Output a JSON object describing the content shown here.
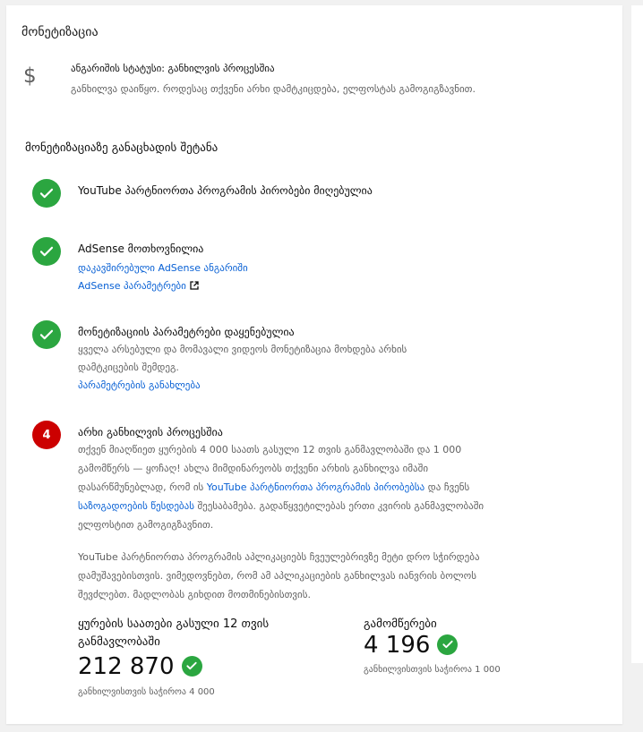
{
  "page": {
    "title": "მონეტიზაცია"
  },
  "account_status": {
    "icon": "dollar-icon",
    "title": "ანგარიშის სტატუსი: განხილვის პროცესშია",
    "description": "განხილვა დაიწყო. როდესაც თქვენი არხი დამტკიცდება, ელფოსტას გამოგიგზავნით."
  },
  "application": {
    "heading": "მონეტიზაციაზე განაცხადის შეტანა",
    "steps": [
      {
        "status": "done",
        "title": "YouTube პარტნიორთა პროგრამის პირობები მიღებულია"
      },
      {
        "status": "done",
        "title": "AdSense მოთხოვნილია",
        "link1": "დაკავშირებული AdSense ანგარიში",
        "link2": "AdSense პარამეტრები"
      },
      {
        "status": "done",
        "title": "მონეტიზაციის პარამეტრები დაყენებულია",
        "description": "ყველა არსებული და მომავალი ვიდეოს მონეტიზაცია მოხდება არხის დამტკიცების შემდეგ.",
        "link1": "პარამეტრების განახლება"
      },
      {
        "status": "in_progress",
        "number": "4",
        "title": "არხი განხილვის პროცესშია",
        "para1_a": "თქვენ მიაღწიეთ ყურების 4 000 საათს გასული 12 თვის განმავლობაში და 1 000 გამომწერს — ყოჩაღ! ახლა მიმდინარეობს თქვენი არხის განხილვა იმაში დასარწმუნებლად, რომ ის ",
        "para1_link1": "YouTube პარტნიორთა პროგრამის პირობებსა",
        "para1_b": " და ჩვენს ",
        "para1_link2": "საზოგადოების წესდებას",
        "para1_c": " შეესაბამება. გადაწყვეტილებას ერთი კვირის განმავლობაში ელფოსტით გამოგიგზავნით.",
        "para2": "YouTube პარტნიორთა პროგრამის აპლიკაციებს ჩვეულებრივზე მეტი დრო სჭირდება დამუშავებისთვის. ვიმედოვნებთ, რომ ამ აპლიკაციების განხილვას იანვრის ბოლოს შევძლებთ. მადლობას გიხდით მოთმინებისთვის."
      }
    ]
  },
  "stats": {
    "watch_hours": {
      "label": "ყურების საათები გასული 12 თვის განმავლობაში",
      "value": "212 870",
      "requirement": "განხილვისთვის საჭიროა 4 000"
    },
    "subscribers": {
      "label": "გამომწერები",
      "value": "4 196",
      "requirement": "განხილვისთვის საჭიროა 1 000"
    }
  },
  "colors": {
    "success": "#2ba640",
    "pending": "#cc0000",
    "link": "#065fd4",
    "muted": "#606060"
  }
}
